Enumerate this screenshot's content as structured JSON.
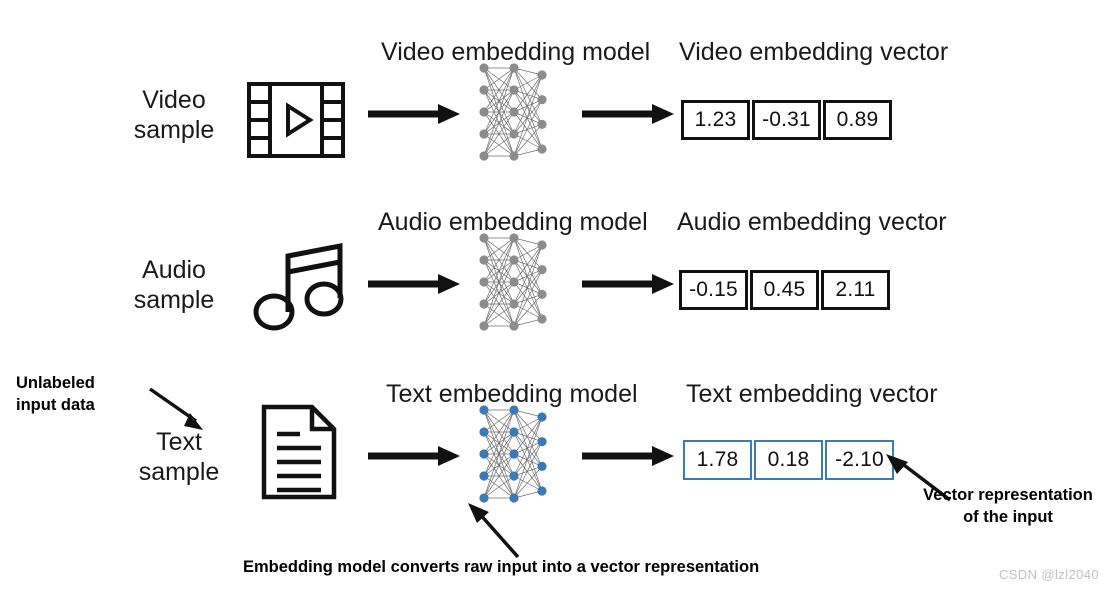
{
  "meta": {
    "title": "Embedding model pipeline diagram",
    "background": "#ffffff",
    "ink": "#111111",
    "accent_blue": "#3a7ab5",
    "node_gray": "#8c8c8c",
    "watermark": "CSDN @lzl2040"
  },
  "rows": [
    {
      "id": "video",
      "sample_label": "Video\nsample",
      "icon": "film-strip-icon",
      "model_heading": "Video embedding model",
      "vector_heading": "Video embedding vector",
      "network_color": "#8c8c8c",
      "vector_color": "#111111",
      "vector_values": [
        "1.23",
        "-0.31",
        "0.89"
      ]
    },
    {
      "id": "audio",
      "sample_label": "Audio\nsample",
      "icon": "music-note-icon",
      "model_heading": "Audio embedding model",
      "vector_heading": "Audio embedding vector",
      "network_color": "#8c8c8c",
      "vector_color": "#111111",
      "vector_values": [
        "-0.15",
        "0.45",
        "2.11"
      ]
    },
    {
      "id": "text",
      "sample_label": "Text\nsample",
      "icon": "document-icon",
      "model_heading": "Text embedding model",
      "vector_heading": "Text embedding vector",
      "network_color": "#3a7ab5",
      "vector_color": "#3a7ab5",
      "vector_values": [
        "1.78",
        "0.18",
        "-2.10"
      ]
    }
  ],
  "annotations": {
    "unlabeled_input": "Unlabeled\ninput data",
    "embedding_model_note": "Embedding model converts raw input into a vector representation",
    "vector_representation": "Vector representation\nof the input"
  },
  "network": {
    "layer_counts": [
      5,
      5,
      4
    ],
    "node_radius": 4.6
  }
}
